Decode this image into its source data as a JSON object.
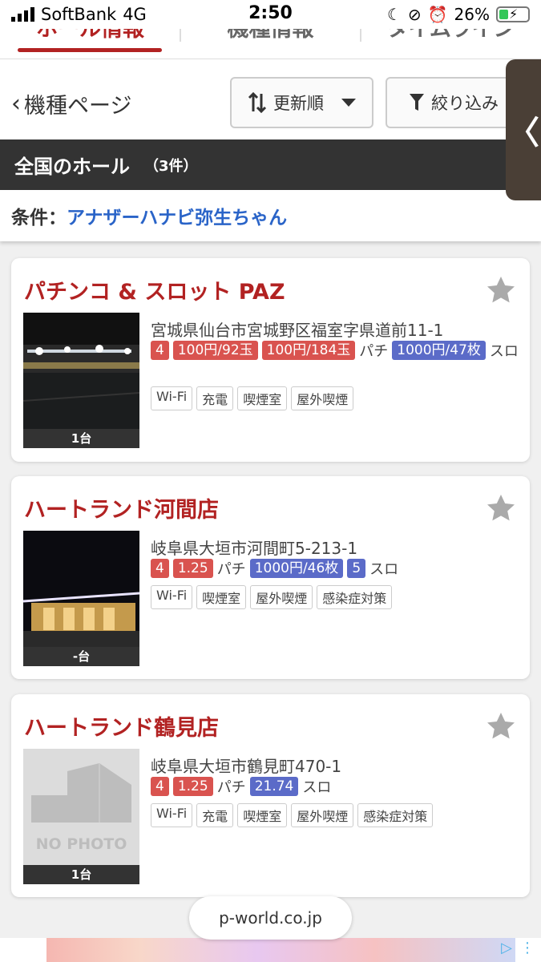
{
  "status_bar": {
    "carrier": "SoftBank",
    "network": "4G",
    "time": "2:50",
    "battery": "26%"
  },
  "tabs": [
    {
      "label": "ホール情報",
      "active": true
    },
    {
      "label": "機種情報",
      "active": false
    },
    {
      "label": "タイムライン",
      "active": false
    }
  ],
  "toolbar": {
    "back_label": "機種ページ",
    "sort_label": "更新順",
    "filter_label": "絞り込み"
  },
  "side_handle": "〈",
  "section": {
    "title": "全国のホール",
    "count": "（3件）"
  },
  "condition": {
    "label": "条件：",
    "value": "アナザーハナビ弥生ちゃん"
  },
  "halls": [
    {
      "name": "パチンコ & スロット PAZ",
      "address": "宮城県仙台市宮城野区福室字県道前11-1",
      "count_label": "1台",
      "photo": "night-storefront",
      "pachi_tags": [
        "4",
        "100円/92玉",
        "100円/184玉"
      ],
      "pachi_label": "パチ",
      "slot_tags": [
        "1000円/47枚"
      ],
      "slot_label": "スロ",
      "amenities": [
        "Wi-Fi",
        "充電",
        "喫煙室",
        "屋外喫煙"
      ]
    },
    {
      "name": "ハートランド河間店",
      "address": "岐阜県大垣市河間町5-213-1",
      "count_label": "-台",
      "photo": "night-building",
      "pachi_tags": [
        "4",
        "1.25"
      ],
      "pachi_label": "パチ",
      "slot_tags": [
        "1000円/46枚",
        "5"
      ],
      "slot_label": "スロ",
      "amenities": [
        "Wi-Fi",
        "喫煙室",
        "屋外喫煙",
        "感染症対策"
      ]
    },
    {
      "name": "ハートランド鶴見店",
      "address": "岐阜県大垣市鶴見町470-1",
      "count_label": "1台",
      "photo": "no-photo",
      "no_photo_text": "NO PHOTO",
      "pachi_tags": [
        "4",
        "1.25"
      ],
      "pachi_label": "パチ",
      "slot_tags": [
        "21.74"
      ],
      "slot_label": "スロ",
      "amenities": [
        "Wi-Fi",
        "充電",
        "喫煙室",
        "屋外喫煙",
        "感染症対策"
      ]
    }
  ],
  "url_bar": "p-world.co.jp",
  "colors": {
    "accent_red": "#b22222",
    "tag_red": "#d9534f",
    "tag_blue": "#5b6bc8",
    "link_blue": "#2a64c8",
    "header_dark": "#333333"
  }
}
